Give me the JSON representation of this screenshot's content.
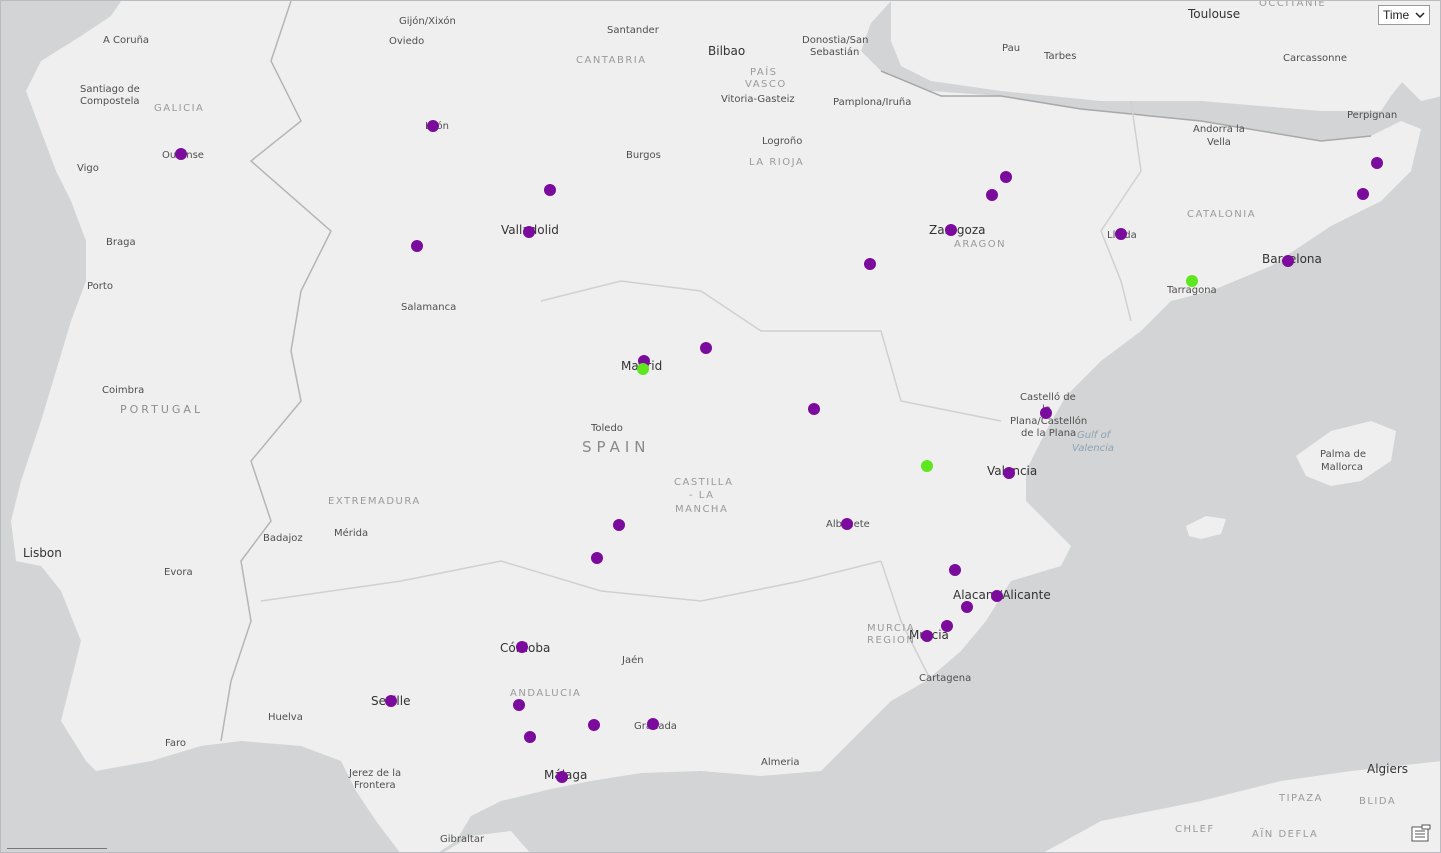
{
  "controls": {
    "time_select": {
      "value": "Time",
      "icon": "chevron-down-icon"
    },
    "legend_icon": "legend-icon"
  },
  "colors": {
    "land": "#efefef",
    "sea": "#d2d4d5",
    "border": "#b5b5b5",
    "marker_purple": "#7a0b9c",
    "marker_green": "#5ee61e"
  },
  "labels": {
    "toulouse": "Toulouse",
    "occitanie": "OCCITANIE",
    "gijon": "Gijón/Xixón",
    "santander": "Santander",
    "acoruna": "A Coruña",
    "oviedo": "Oviedo",
    "bilbao": "Bilbao",
    "donostia1": "Donostia/San",
    "donostia2": "Sebastián",
    "pau": "Pau",
    "tarbes": "Tarbes",
    "carcassonne": "Carcassonne",
    "cantabria": "CANTABRIA",
    "santiago1": "Santiago de",
    "santiago2": "Compostela",
    "galicia": "GALICIA",
    "paisvasco1": "PAÍS",
    "paisvasco2": "VASCO",
    "vitoria": "Vitoria-Gasteiz",
    "pamplona": "Pamplona/Iruña",
    "perpignan": "Perpignan",
    "andorra1": "Andorra la",
    "andorra2": "Vella",
    "leon": "León",
    "logrono": "Logroño",
    "ourense": "Ourense",
    "burgos": "Burgos",
    "larioja": "LA RIOJA",
    "vigo": "Vigo",
    "catalonia": "CATALONIA",
    "braga": "Braga",
    "valladolid": "Valladolid",
    "zaragoza": "Zaragoza",
    "aragon": "ARAGON",
    "lleida": "Lleida",
    "barcelona": "Barcelona",
    "porto": "Porto",
    "tarragona": "Tarragona",
    "salamanca": "Salamanca",
    "madrid": "Madrid",
    "coimbra": "Coimbra",
    "portugal": "PORTUGAL",
    "castello1": "Castelló de",
    "castello2": "la",
    "castello3": "Plana/Castellón",
    "castello4": "de la Plana",
    "gulf1": "Gulf of",
    "gulf2": "Valencia",
    "toledo": "Toledo",
    "spain": "SPAIN",
    "palma1": "Palma de",
    "palma2": "Mallorca",
    "valencia": "Valencia",
    "castilla1": "CASTILLA",
    "castilla2": "- LA",
    "castilla3": "MANCHA",
    "extremadura": "EXTREMADURA",
    "albacete": "Albacete",
    "merida": "Mérida",
    "lisbon": "Lisbon",
    "badajoz": "Badajoz",
    "evora": "Evora",
    "alicante": "Alacant/Alicante",
    "murciaregion1": "MURCIA",
    "murciaregion2": "REGION",
    "murcia": "Murcia",
    "cordoba": "Córdoba",
    "jaen": "Jaén",
    "cartagena": "Cartagena",
    "andalucia": "ANDALUCIA",
    "sevilla": "Seville",
    "huelva": "Huelva",
    "granada": "Granada",
    "faro": "Faro",
    "almeria": "Almeria",
    "jerez1": "Jerez de la",
    "jerez2": "Frontera",
    "malaga": "Málaga",
    "algiers": "Algiers",
    "tipaza": "TIPAZA",
    "blida": "BLIDA",
    "chlef": "CHLEF",
    "aindefla": "AÏN DEFLA",
    "gibraltar": "Gibraltar"
  },
  "markers": [
    {
      "place": "Ourense",
      "status": "purple"
    },
    {
      "place": "León",
      "status": "purple"
    },
    {
      "place": "Palencia area",
      "status": "purple"
    },
    {
      "place": "Valladolid",
      "status": "purple"
    },
    {
      "place": "Zamora area",
      "status": "purple"
    },
    {
      "place": "Huesca area north",
      "status": "purple"
    },
    {
      "place": "Huesca area",
      "status": "purple"
    },
    {
      "place": "Zaragoza",
      "status": "purple"
    },
    {
      "place": "Calatayud area",
      "status": "purple"
    },
    {
      "place": "Lleida",
      "status": "purple"
    },
    {
      "place": "Girona north",
      "status": "purple"
    },
    {
      "place": "Girona",
      "status": "purple"
    },
    {
      "place": "Barcelona",
      "status": "purple"
    },
    {
      "place": "Tarragona",
      "status": "green"
    },
    {
      "place": "Madrid",
      "status": "purple"
    },
    {
      "place": "Madrid",
      "status": "green"
    },
    {
      "place": "Guadalajara area",
      "status": "purple"
    },
    {
      "place": "Cuenca area",
      "status": "purple"
    },
    {
      "place": "Castelló",
      "status": "purple"
    },
    {
      "place": "Valencia inland",
      "status": "green"
    },
    {
      "place": "Valencia",
      "status": "purple"
    },
    {
      "place": "Ciudad Real area",
      "status": "purple"
    },
    {
      "place": "Puertollano area",
      "status": "purple"
    },
    {
      "place": "Albacete",
      "status": "purple"
    },
    {
      "place": "Elda area",
      "status": "purple"
    },
    {
      "place": "Alicante",
      "status": "purple"
    },
    {
      "place": "Elche area",
      "status": "purple"
    },
    {
      "place": "Orihuela area",
      "status": "purple"
    },
    {
      "place": "Murcia",
      "status": "purple"
    },
    {
      "place": "Córdoba",
      "status": "purple"
    },
    {
      "place": "Sevilla",
      "status": "purple"
    },
    {
      "place": "Écija area",
      "status": "purple"
    },
    {
      "place": "Antequera area",
      "status": "purple"
    },
    {
      "place": "Loja area",
      "status": "purple"
    },
    {
      "place": "Granada",
      "status": "purple"
    },
    {
      "place": "Málaga",
      "status": "purple"
    }
  ]
}
